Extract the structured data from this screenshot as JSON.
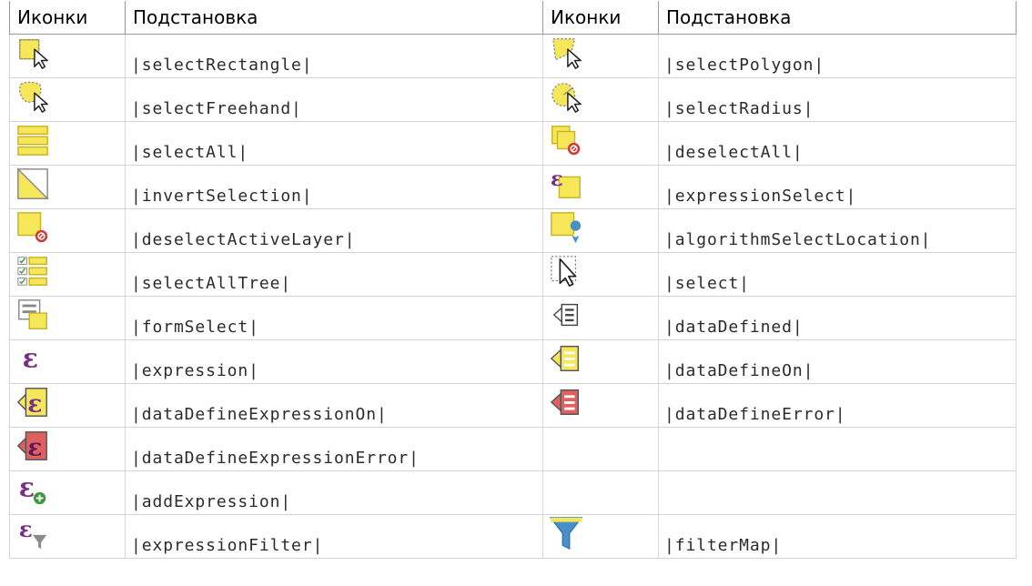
{
  "headers": {
    "icons_1": "Иконки",
    "substitution_1": "Подстановка",
    "icons_2": "Иконки",
    "substitution_2": "Подстановка"
  },
  "rows": [
    {
      "left": {
        "icon": "select-rectangle-icon",
        "text": "|selectRectangle|"
      },
      "right": {
        "icon": "select-polygon-icon",
        "text": "|selectPolygon|"
      }
    },
    {
      "left": {
        "icon": "select-freehand-icon",
        "text": "|selectFreehand|"
      },
      "right": {
        "icon": "select-radius-icon",
        "text": "|selectRadius|"
      }
    },
    {
      "left": {
        "icon": "select-all-icon",
        "text": "|selectAll|"
      },
      "right": {
        "icon": "deselect-all-icon",
        "text": "|deselectAll|"
      }
    },
    {
      "left": {
        "icon": "invert-selection-icon",
        "text": "|invertSelection|"
      },
      "right": {
        "icon": "expression-select-icon",
        "text": "|expressionSelect|"
      }
    },
    {
      "left": {
        "icon": "deselect-active-layer-icon",
        "text": "|deselectActiveLayer|"
      },
      "right": {
        "icon": "algorithm-select-location-icon",
        "text": "|algorithmSelectLocation|"
      }
    },
    {
      "left": {
        "icon": "select-all-tree-icon",
        "text": "|selectAllTree|"
      },
      "right": {
        "icon": "select-icon",
        "text": "|select|"
      }
    },
    {
      "left": {
        "icon": "form-select-icon",
        "text": "|formSelect|"
      },
      "right": {
        "icon": "data-defined-icon",
        "text": "|dataDefined|"
      }
    },
    {
      "left": {
        "icon": "expression-icon",
        "text": "|expression|"
      },
      "right": {
        "icon": "data-define-on-icon",
        "text": "|dataDefineOn|"
      }
    },
    {
      "left": {
        "icon": "data-define-expression-on-icon",
        "text": "|dataDefineExpressionOn|"
      },
      "right": {
        "icon": "data-define-error-icon",
        "text": "|dataDefineError|"
      }
    },
    {
      "left": {
        "icon": "data-define-expression-error-icon",
        "text": "|dataDefineExpressionError|"
      },
      "right": null
    },
    {
      "left": {
        "icon": "add-expression-icon",
        "text": "|addExpression|"
      },
      "right": null
    },
    {
      "left": {
        "icon": "expression-filter-icon",
        "text": "|expressionFilter|"
      },
      "right": {
        "icon": "filter-map-icon",
        "text": "|filterMap|"
      }
    }
  ],
  "colors": {
    "yellow": "#f5e65a",
    "yellow_dark": "#c8b420",
    "purple": "#7a2f86",
    "red": "#d23a3a",
    "blue": "#4a90c8"
  },
  "epsilon_glyph": "ε"
}
